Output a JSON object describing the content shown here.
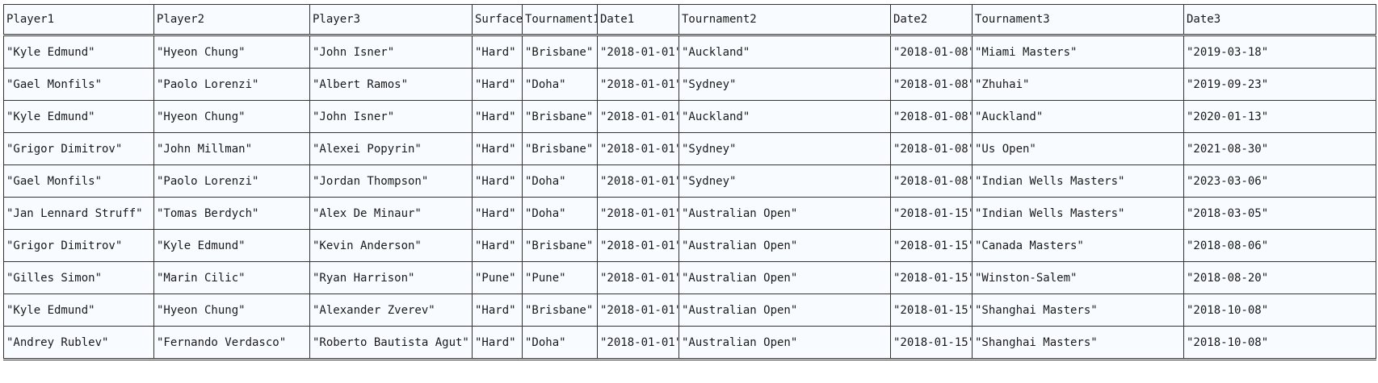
{
  "table": {
    "headers": [
      "Player1",
      "Player2",
      "Player3",
      "Surface",
      "Tournament1",
      "Date1",
      "Tournament2",
      "Date2",
      "Tournament3",
      "Date3"
    ],
    "rows": [
      [
        "\"Kyle Edmund\"",
        "\"Hyeon Chung\"",
        "\"John Isner\"",
        "\"Hard\"",
        "\"Brisbane\"",
        "\"2018-01-01\"",
        "\"Auckland\"",
        "\"2018-01-08\"",
        "\"Miami Masters\"",
        "\"2019-03-18\""
      ],
      [
        "\"Gael Monfils\"",
        "\"Paolo Lorenzi\"",
        "\"Albert Ramos\"",
        "\"Hard\"",
        "\"Doha\"",
        "\"2018-01-01\"",
        "\"Sydney\"",
        "\"2018-01-08\"",
        "\"Zhuhai\"",
        "\"2019-09-23\""
      ],
      [
        "\"Kyle Edmund\"",
        "\"Hyeon Chung\"",
        "\"John Isner\"",
        "\"Hard\"",
        "\"Brisbane\"",
        "\"2018-01-01\"",
        "\"Auckland\"",
        "\"2018-01-08\"",
        "\"Auckland\"",
        "\"2020-01-13\""
      ],
      [
        "\"Grigor Dimitrov\"",
        "\"John Millman\"",
        "\"Alexei Popyrin\"",
        "\"Hard\"",
        "\"Brisbane\"",
        "\"2018-01-01\"",
        "\"Sydney\"",
        "\"2018-01-08\"",
        "\"Us Open\"",
        "\"2021-08-30\""
      ],
      [
        "\"Gael Monfils\"",
        "\"Paolo Lorenzi\"",
        "\"Jordan Thompson\"",
        "\"Hard\"",
        "\"Doha\"",
        "\"2018-01-01\"",
        "\"Sydney\"",
        "\"2018-01-08\"",
        "\"Indian Wells Masters\"",
        "\"2023-03-06\""
      ],
      [
        "\"Jan Lennard Struff\"",
        "\"Tomas Berdych\"",
        "\"Alex De Minaur\"",
        "\"Hard\"",
        "\"Doha\"",
        "\"2018-01-01\"",
        "\"Australian Open\"",
        "\"2018-01-15\"",
        "\"Indian Wells Masters\"",
        "\"2018-03-05\""
      ],
      [
        "\"Grigor Dimitrov\"",
        "\"Kyle Edmund\"",
        "\"Kevin Anderson\"",
        "\"Hard\"",
        "\"Brisbane\"",
        "\"2018-01-01\"",
        "\"Australian Open\"",
        "\"2018-01-15\"",
        "\"Canada Masters\"",
        "\"2018-08-06\""
      ],
      [
        "\"Gilles Simon\"",
        "\"Marin Cilic\"",
        "\"Ryan Harrison\"",
        "\"Pune\"",
        "\"Pune\"",
        "\"2018-01-01\"",
        "\"Australian Open\"",
        "\"2018-01-15\"",
        "\"Winston-Salem\"",
        "\"2018-08-20\""
      ],
      [
        "\"Kyle Edmund\"",
        "\"Hyeon Chung\"",
        "\"Alexander Zverev\"",
        "\"Hard\"",
        "\"Brisbane\"",
        "\"2018-01-01\"",
        "\"Australian Open\"",
        "\"2018-01-15\"",
        "\"Shanghai Masters\"",
        "\"2018-10-08\""
      ],
      [
        "\"Andrey Rublev\"",
        "\"Fernando Verdasco\"",
        "\"Roberto Bautista Agut\"",
        "\"Hard\"",
        "\"Doha\"",
        "\"2018-01-01\"",
        "\"Australian Open\"",
        "\"2018-01-15\"",
        "\"Shanghai Masters\"",
        "\"2018-10-08\""
      ]
    ]
  }
}
